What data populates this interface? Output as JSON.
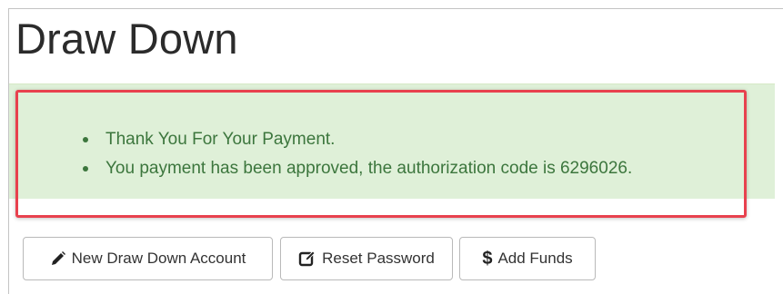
{
  "page": {
    "title": "Draw Down"
  },
  "alert": {
    "messages": [
      "Thank You For Your Payment.",
      "You payment has been approved, the authorization code is 6296026."
    ],
    "background_color": "#dff0d8",
    "text_color": "#3c763d",
    "highlight_color": "#e8414e"
  },
  "actions": {
    "new_account": {
      "label": "New Draw Down Account",
      "icon": "pencil-icon"
    },
    "reset_password": {
      "label": "Reset Password",
      "icon": "edit-square-icon"
    },
    "add_funds": {
      "label": "Add Funds",
      "icon_glyph": "$",
      "icon": "dollar-icon"
    }
  }
}
